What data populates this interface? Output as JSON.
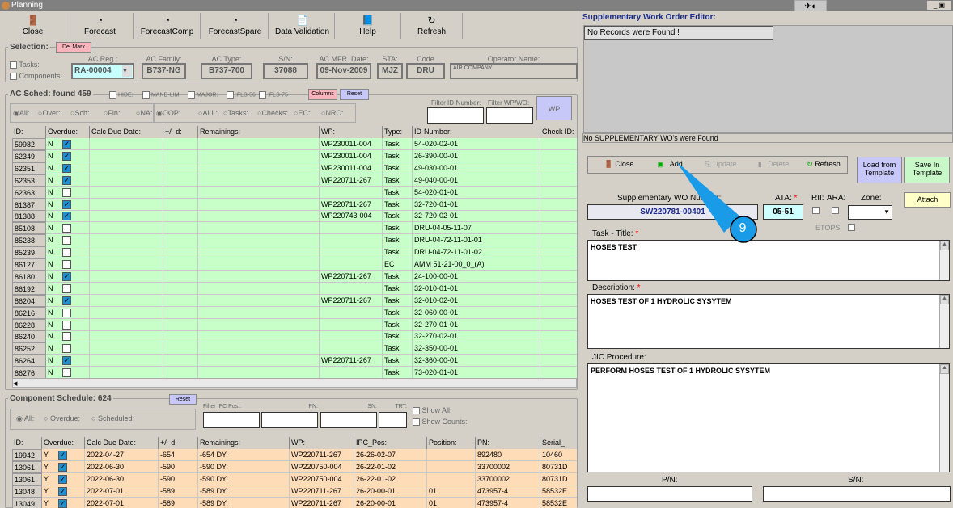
{
  "window": {
    "title": "Planning"
  },
  "toolbar": [
    {
      "label": "Close",
      "icon": "door-exit-icon"
    },
    {
      "label": "Forecast",
      "icon": "forecast-icon"
    },
    {
      "label": "ForecastComp",
      "icon": "forecast-icon"
    },
    {
      "label": "ForecastSpare",
      "icon": "forecast-icon"
    },
    {
      "label": "Data Validation",
      "icon": "document-check-icon"
    },
    {
      "label": "Help",
      "icon": "help-book-icon"
    },
    {
      "label": "Refresh",
      "icon": "refresh-icon"
    }
  ],
  "selection": {
    "title": "Selection:",
    "del_mark": "Del Mark",
    "tasks": "Tasks:",
    "components": "Components:",
    "fields": [
      {
        "label": "AC Reg.:",
        "value": "RA-00004"
      },
      {
        "label": "AC Family:",
        "value": "B737-NG"
      },
      {
        "label": "AC Type:",
        "value": "B737-700"
      },
      {
        "label": "S/N:",
        "value": "37088"
      },
      {
        "label": "AC MFR. Date:",
        "value": "09-Nov-2009"
      },
      {
        "label": "STA:",
        "value": "MJZ"
      },
      {
        "label": "Code ICAO:",
        "value": "DRU"
      },
      {
        "label": "Operator Name:",
        "value": "AIR COMPANY"
      }
    ]
  },
  "ac_sched": {
    "title": "AC Sched: found",
    "count": "459",
    "filters": [
      "HIDE:",
      "MAND-LIM:",
      "MAJOR:",
      ":FLS-56",
      ":FLS-75"
    ],
    "columns_btn": "Columns",
    "reset_btn": "Reset",
    "radios1": [
      "All:",
      "Over:",
      "Sch:",
      "Fin:",
      "NA:"
    ],
    "radios2": [
      "OOP:",
      "ALL:",
      "Tasks:",
      "Checks:",
      "EC:",
      "NRC:"
    ],
    "filter_id": "Filter ID-Number:",
    "filter_wp": "Filter WP/WO:",
    "wp_btn": "WP",
    "headers": [
      "ID:",
      "Overdue:",
      "Calc Due Date:",
      "+/- d:",
      "Remainings:",
      "WP:",
      "Type:",
      "ID-Number:",
      "Check ID:"
    ],
    "rows": [
      [
        "59982",
        "N",
        true,
        "WP230011-004",
        "Task",
        "54-020-02-01"
      ],
      [
        "62349",
        "N",
        true,
        "WP230011-004",
        "Task",
        "26-390-00-01"
      ],
      [
        "62351",
        "N",
        true,
        "WP230011-004",
        "Task",
        "49-030-00-01"
      ],
      [
        "62353",
        "N",
        true,
        "WP220711-267",
        "Task",
        "49-040-00-01"
      ],
      [
        "62363",
        "N",
        false,
        "",
        "Task",
        "54-020-01-01"
      ],
      [
        "81387",
        "N",
        true,
        "WP220711-267",
        "Task",
        "32-720-01-01"
      ],
      [
        "81388",
        "N",
        true,
        "WP220743-004",
        "Task",
        "32-720-02-01"
      ],
      [
        "85108",
        "N",
        false,
        "",
        "Task",
        "DRU-04-05-11-07"
      ],
      [
        "85238",
        "N",
        false,
        "",
        "Task",
        "DRU-04-72-11-01-01"
      ],
      [
        "85239",
        "N",
        false,
        "",
        "Task",
        "DRU-04-72-11-01-02"
      ],
      [
        "86127",
        "N",
        false,
        "",
        "EC",
        "AMM 51-21-00_0_(A)"
      ],
      [
        "86180",
        "N",
        true,
        "WP220711-267",
        "Task",
        "24-100-00-01"
      ],
      [
        "86192",
        "N",
        false,
        "",
        "Task",
        "32-010-01-01"
      ],
      [
        "86204",
        "N",
        true,
        "WP220711-267",
        "Task",
        "32-010-02-01"
      ],
      [
        "86216",
        "N",
        false,
        "",
        "Task",
        "32-060-00-01"
      ],
      [
        "86228",
        "N",
        false,
        "",
        "Task",
        "32-270-01-01"
      ],
      [
        "86240",
        "N",
        false,
        "",
        "Task",
        "32-270-02-01"
      ],
      [
        "86252",
        "N",
        false,
        "",
        "Task",
        "32-350-00-01"
      ],
      [
        "86264",
        "N",
        true,
        "WP220711-267",
        "Task",
        "32-360-00-01"
      ],
      [
        "86276",
        "N",
        false,
        "",
        "Task",
        "73-020-01-01"
      ]
    ]
  },
  "comp_sched": {
    "title": "Component Schedule: 624",
    "reset_btn": "Reset",
    "radios": [
      "All:",
      "Overdue:",
      "Scheduled:"
    ],
    "filters": [
      "Filter IPC Pos.:",
      "PN:",
      "SN:",
      "TRT:"
    ],
    "show_all": "Show All:",
    "show_counts": "Show Counts:",
    "headers": [
      "ID:",
      "Overdue:",
      "Calc Due Date:",
      "+/- d:",
      "Remainings:",
      "WP:",
      "IPC_Pos:",
      "Position:",
      "PN:",
      "Serial_"
    ],
    "rows": [
      [
        "19942",
        "Y",
        true,
        "2022-04-27",
        "-654",
        "-654 DY;",
        "WP220711-267",
        "26-26-02-07",
        "",
        "892480",
        "10460"
      ],
      [
        "13061",
        "Y",
        true,
        "2022-06-30",
        "-590",
        "-590 DY;",
        "WP220750-004",
        "26-22-01-02",
        "",
        "33700002",
        "80731D"
      ],
      [
        "13061",
        "Y",
        true,
        "2022-06-30",
        "-590",
        "-590 DY;",
        "WP220750-004",
        "26-22-01-02",
        "",
        "33700002",
        "80731D"
      ],
      [
        "13048",
        "Y",
        true,
        "2022-07-01",
        "-589",
        "-589 DY;",
        "WP220711-267",
        "26-20-00-01",
        "01",
        "473957-4",
        "58532E"
      ],
      [
        "13049",
        "Y",
        true,
        "2022-07-01",
        "-589",
        "-589 DY;",
        "WP220711-267",
        "26-20-00-01",
        "01",
        "473957-4",
        "58532E"
      ]
    ]
  },
  "editor": {
    "title": "Supplementary Work Order Editor:",
    "no_records": "No Records were Found !",
    "no_supp": "No SUPPLEMENTARY WO's were Found",
    "buttons": {
      "close": "Close",
      "add": "Add",
      "update": "Update",
      "delete": "Delete",
      "refresh": "Refresh",
      "load": "Load from Template",
      "save": "Save In Template",
      "attach": "Attach"
    },
    "wo_label": "Supplementary WO Number:",
    "wo_value": "SW220781-00401",
    "ata_label": "ATA:",
    "ata_value": "05-51",
    "rii": "RII:",
    "ara": "ARA:",
    "zone": "Zone:",
    "etops": "ETOPS:",
    "task_title_label": "Task - Title:",
    "task_title": "HOSES TEST",
    "desc_label": "Description:",
    "desc": "HOSES TEST OF 1 HYDROLIC SYSYTEM",
    "jic_label": "JIC Procedure:",
    "jic": "PERFORM HOSES TEST OF 1 HYDROLIC SYSYTEM",
    "pn": "P/N:",
    "sn": "S/N:",
    "required": "*"
  },
  "callout": {
    "number": "9",
    "color": "#1a9be8"
  }
}
